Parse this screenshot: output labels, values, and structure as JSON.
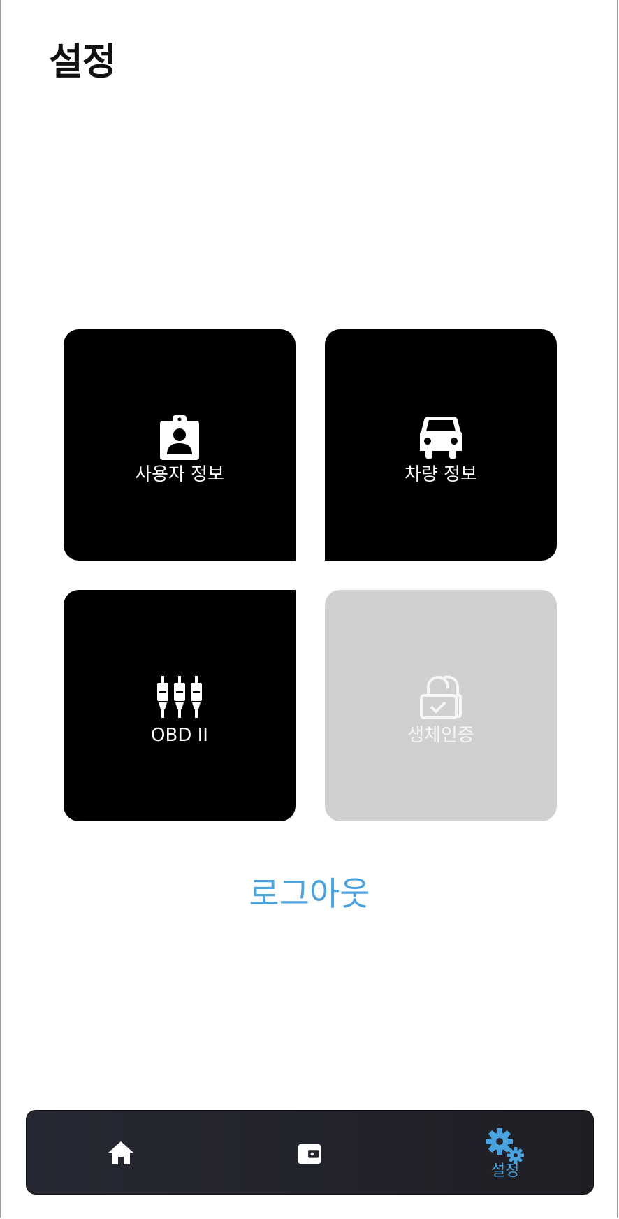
{
  "header": {
    "title": "설정"
  },
  "tiles": [
    {
      "label": "사용자 정보",
      "icon": "id-badge-icon",
      "enabled": true
    },
    {
      "label": "차량 정보",
      "icon": "car-icon",
      "enabled": true
    },
    {
      "label": "OBD II",
      "icon": "obd-connector-icon",
      "enabled": true
    },
    {
      "label": "생체인증",
      "icon": "lock-check-icon",
      "enabled": false
    }
  ],
  "logout": {
    "label": "로그아웃"
  },
  "bottom_nav": {
    "items": [
      {
        "icon": "home-icon",
        "label": "",
        "active": false
      },
      {
        "icon": "wallet-icon",
        "label": "",
        "active": false
      },
      {
        "icon": "gears-icon",
        "label": "설정",
        "active": true
      }
    ]
  },
  "colors": {
    "accent": "#4aa3df",
    "tile": "#000000",
    "tile_disabled": "#d0d0d0",
    "nav_background": "#23242c"
  }
}
